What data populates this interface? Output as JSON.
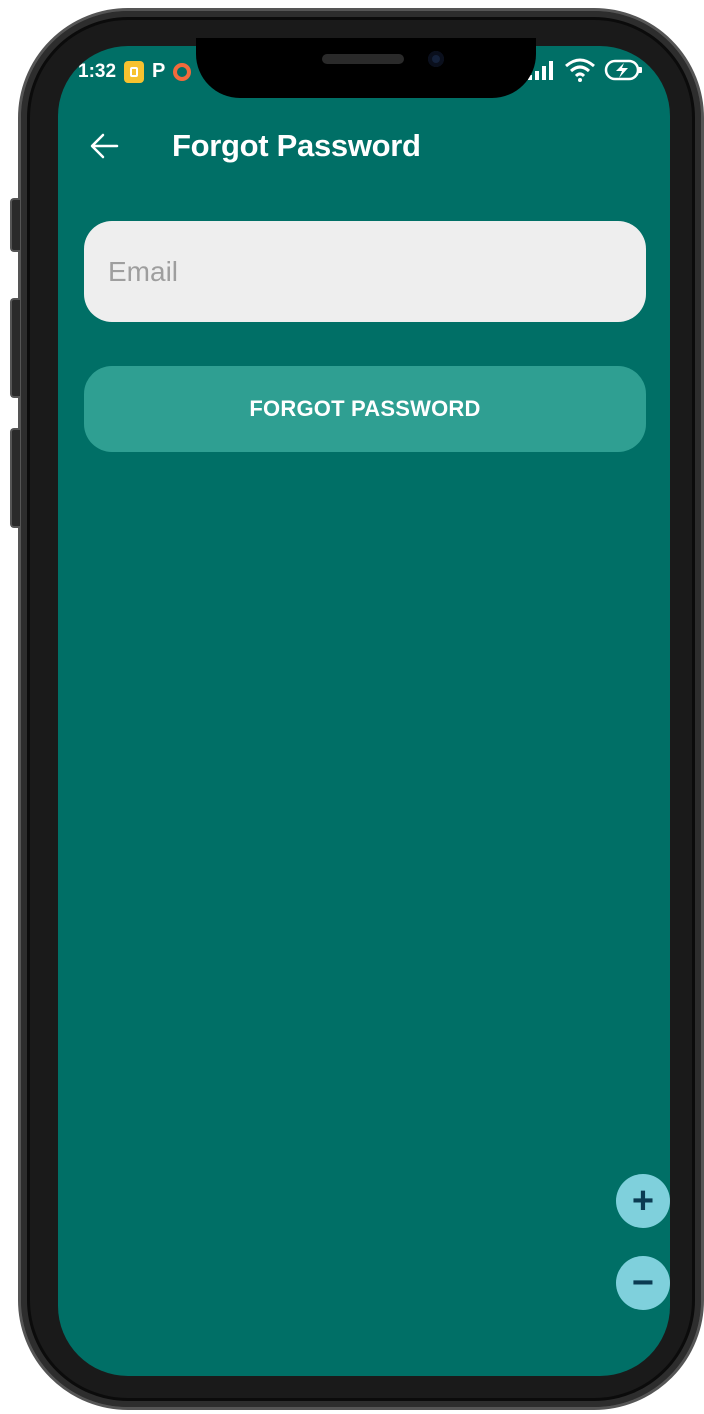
{
  "status_bar": {
    "time": "1:32",
    "left_icons": [
      "notification-app-icon",
      "p-icon",
      "ring-icon"
    ],
    "right_icons": [
      "signal-icon",
      "signal-icon",
      "wifi-icon",
      "battery-charging-icon"
    ]
  },
  "app_bar": {
    "back_icon": "arrow-left-icon",
    "title": "Forgot Password"
  },
  "form": {
    "email_placeholder": "Email",
    "email_value": "",
    "submit_label": "FORGOT PASSWORD"
  },
  "zoom_controls": {
    "zoom_in_label": "+",
    "zoom_out_label": "−"
  },
  "colors": {
    "background": "#006f66",
    "button": "#2f9f92",
    "input": "#eeeeee",
    "zoom": "#7fd0dc"
  }
}
